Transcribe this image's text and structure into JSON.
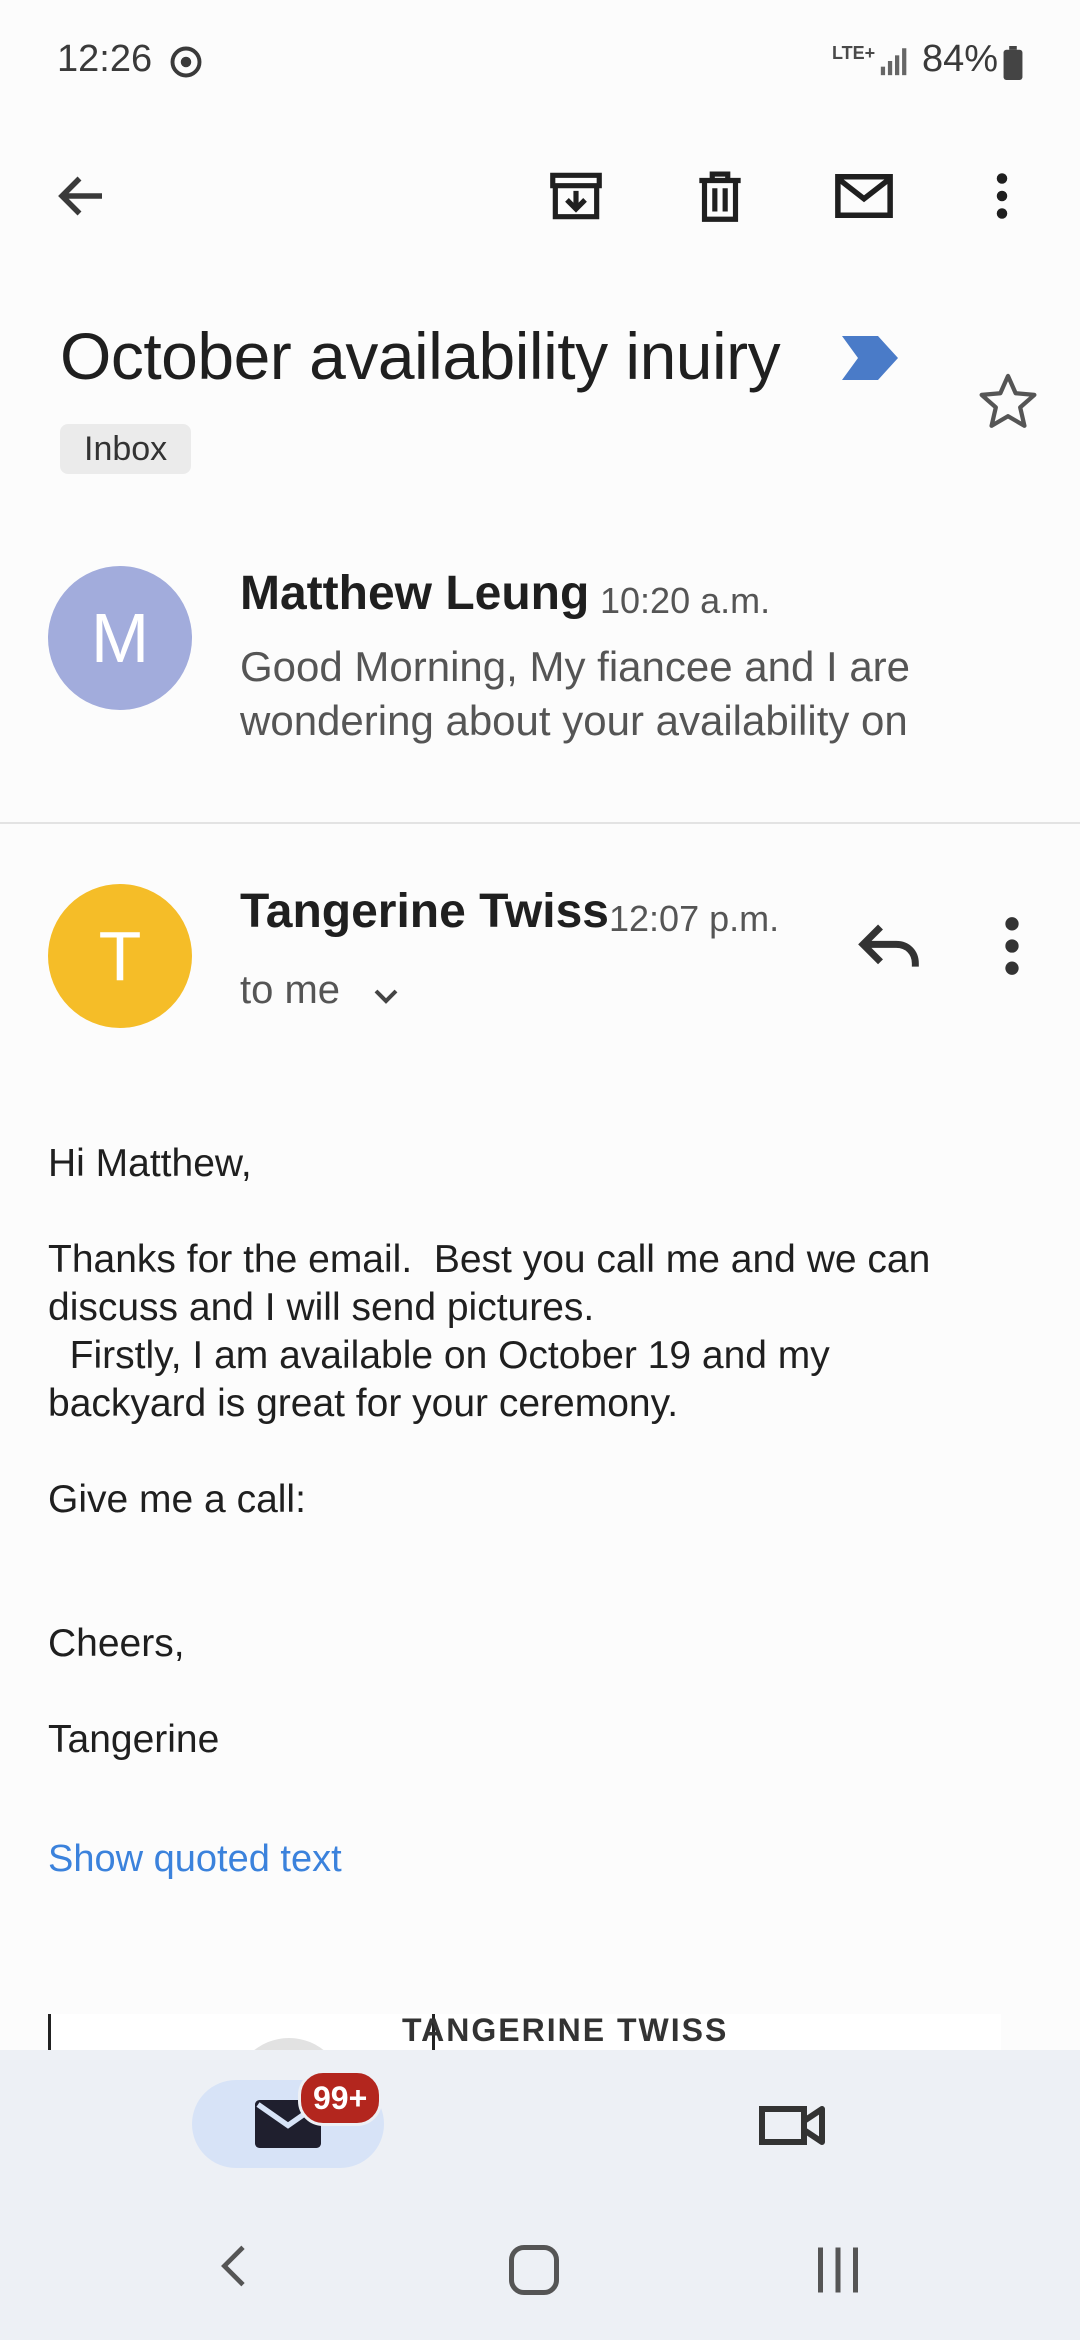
{
  "status_bar": {
    "time": "12:26",
    "network": "LTE+",
    "battery": "84%"
  },
  "toolbar": {
    "back": "back-arrow-icon",
    "archive": "archive-icon",
    "delete": "trash-icon",
    "mark_unread": "mail-icon",
    "more": "more-vert-icon"
  },
  "thread": {
    "subject": "October availability inuiry",
    "label": "Inbox",
    "colors": {
      "label_marker": "#4a7bc8"
    }
  },
  "messages": [
    {
      "avatar_letter": "M",
      "sender": "Matthew Leung",
      "time": "10:20 a.m.",
      "snippet_lines": [
        "Good Morning, My fiancee and I are",
        "wondering about your availability on"
      ],
      "avatar_color": "#a2acdc"
    },
    {
      "avatar_letter": "T",
      "sender": "Tangerine Twiss",
      "time": "12:07 p.m.",
      "recipient": "to me",
      "avatar_color": "#f5bd28",
      "body_lines": [
        "Hi Matthew,",
        "Thanks for the email.  Best you call me and we can",
        "discuss and I will send pictures.",
        "  Firstly, I am available on October 19 and my",
        "backyard is great for your ceremony.",
        "Give me a call:",
        "Cheers,",
        "Tangerine"
      ],
      "show_quoted": "Show quoted text",
      "signature_text": "TANGERINE TWISS"
    }
  ],
  "bottom_nav": {
    "mail_badge": "99+"
  }
}
